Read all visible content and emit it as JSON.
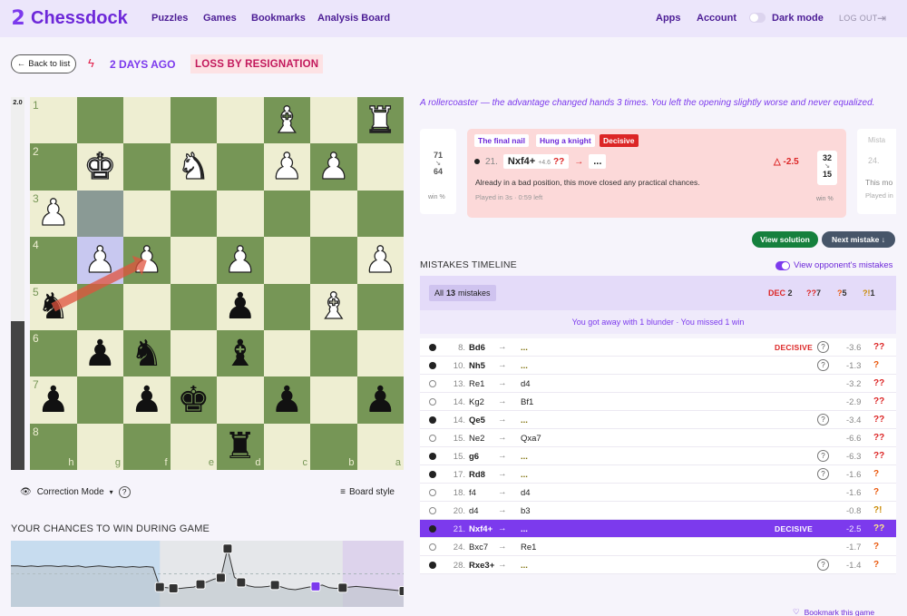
{
  "nav": {
    "logo_text": "Chessdock",
    "links": [
      "Puzzles",
      "Games",
      "Bookmarks",
      "Analysis Board"
    ],
    "apps": "Apps",
    "account": "Account",
    "dark_mode": "Dark mode",
    "logout": "LOG OUT"
  },
  "header": {
    "back": "Back to list",
    "ago": "2 DAYS AGO",
    "result": "LOSS BY RESIGNATION"
  },
  "evalbar": {
    "label": "2.0",
    "white_fraction": 0.59
  },
  "board": {
    "colors": {
      "light": "#eeeed2",
      "dark": "#769656"
    },
    "ranks": [
      "1",
      "2",
      "3",
      "4",
      "5",
      "6",
      "7",
      "8"
    ],
    "files": [
      "h",
      "g",
      "f",
      "e",
      "d",
      "c",
      "b",
      "a"
    ],
    "rows": [
      [
        "",
        "",
        "",
        "",
        "",
        "wB",
        "",
        "wR"
      ],
      [
        "",
        "wK",
        "",
        "wN",
        "",
        "wP",
        "wP",
        ""
      ],
      [
        "wP",
        "",
        "",
        "",
        "",
        "",
        "",
        ""
      ],
      [
        "",
        "wP",
        "wP",
        "",
        "wP",
        "",
        "",
        "wP"
      ],
      [
        "bN",
        "",
        "",
        "",
        "bP",
        "",
        "wB",
        ""
      ],
      [
        "",
        "bP",
        "bN",
        "",
        "bB",
        "",
        "",
        ""
      ],
      [
        "bP",
        "",
        "bP",
        "bK",
        "",
        "bP",
        "",
        "bP"
      ],
      [
        "",
        "",
        "",
        "",
        "bR",
        "",
        "",
        ""
      ]
    ],
    "highlight": [
      [
        2,
        1
      ],
      [
        3,
        1
      ]
    ],
    "arrow": {
      "from": [
        4,
        0
      ],
      "to": [
        3,
        2
      ]
    }
  },
  "under": {
    "correction": "Correction Mode",
    "board_style": "Board style"
  },
  "chances_title": "YOUR CHANCES TO WIN DURING GAME",
  "summary": "A rollercoaster — the advantage changed hands 3 times. You left the opening slightly worse and never equalized.",
  "card": {
    "tags": [
      "The final nail",
      "Hung a knight",
      "Decisive"
    ],
    "num": "21.",
    "move": "Nxf4+",
    "eval_small": "+4.6",
    "qq": "??",
    "best": "...",
    "delta": "-2.5",
    "win_before": "32",
    "win_after": "15",
    "win_lbl": "win %",
    "desc": "Already in a bad position, this move closed any practical chances.",
    "played": "Played in 3s · 0:59 left",
    "prev_win_before": "71",
    "prev_win_after": "64",
    "prev_win_lbl": "win %",
    "next_tag": "Mista",
    "next_num": "24.",
    "next_desc": "This mo",
    "next_played": "Played in"
  },
  "buttons": {
    "solution": "View solution",
    "next": "Next mistake ↓"
  },
  "timeline": {
    "title": "MISTAKES TIMELINE",
    "opponent": "View opponent's mistakes",
    "all": "All",
    "count": "13",
    "mistakes_word": "mistakes",
    "counts": [
      {
        "label": "DEC",
        "value": "2",
        "color": "#dc2626"
      },
      {
        "label": "??",
        "value": "7",
        "color": "#dc2626"
      },
      {
        "label": "?",
        "value": "5",
        "color": "#ea580c"
      },
      {
        "label": "?!",
        "value": "1",
        "color": "#ca8a04"
      }
    ],
    "sub": "You got away with 1 blunder · You missed 1 win",
    "rows": [
      {
        "dot": "filled",
        "num": "8.",
        "move": "Bd6",
        "bold": true,
        "best": "...",
        "decisive": "DECISIVE",
        "q": true,
        "ev": "-3.6",
        "sev": "??",
        "sevc": "red"
      },
      {
        "dot": "filled",
        "num": "10.",
        "move": "Nh5",
        "bold": true,
        "best": "...",
        "decisive": "",
        "q": true,
        "ev": "-1.3",
        "sev": "?",
        "sevc": "orange"
      },
      {
        "dot": "hollow",
        "num": "13.",
        "move": "Re1",
        "bold": false,
        "best": "d4",
        "decisive": "",
        "q": false,
        "ev": "-3.2",
        "sev": "??",
        "sevc": "red"
      },
      {
        "dot": "hollow",
        "num": "14.",
        "move": "Kg2",
        "bold": false,
        "best": "Bf1",
        "decisive": "",
        "q": false,
        "ev": "-2.9",
        "sev": "??",
        "sevc": "red"
      },
      {
        "dot": "filled",
        "num": "14.",
        "move": "Qe5",
        "bold": true,
        "best": "...",
        "decisive": "",
        "q": true,
        "ev": "-3.4",
        "sev": "??",
        "sevc": "red"
      },
      {
        "dot": "hollow",
        "num": "15.",
        "move": "Ne2",
        "bold": false,
        "best": "Qxa7",
        "decisive": "",
        "q": false,
        "ev": "-6.6",
        "sev": "??",
        "sevc": "red"
      },
      {
        "dot": "filled",
        "num": "15.",
        "move": "g6",
        "bold": true,
        "best": "...",
        "decisive": "",
        "q": true,
        "ev": "-6.3",
        "sev": "??",
        "sevc": "red"
      },
      {
        "dot": "filled",
        "num": "17.",
        "move": "Rd8",
        "bold": true,
        "best": "...",
        "decisive": "",
        "q": true,
        "ev": "-1.6",
        "sev": "?",
        "sevc": "orange"
      },
      {
        "dot": "hollow",
        "num": "18.",
        "move": "f4",
        "bold": false,
        "best": "d4",
        "decisive": "",
        "q": false,
        "ev": "-1.6",
        "sev": "?",
        "sevc": "orange"
      },
      {
        "dot": "hollow",
        "num": "20.",
        "move": "d4",
        "bold": false,
        "best": "b3",
        "decisive": "",
        "q": false,
        "ev": "-0.8",
        "sev": "?!",
        "sevc": "yellow"
      },
      {
        "dot": "filled",
        "num": "21.",
        "move": "Nxf4+",
        "bold": true,
        "best": "...",
        "decisive": "DECISIVE",
        "q": false,
        "ev": "-2.5",
        "sev": "??",
        "sevc": "red",
        "selected": true
      },
      {
        "dot": "hollow",
        "num": "24.",
        "move": "Bxc7",
        "bold": false,
        "best": "Re1",
        "decisive": "",
        "q": false,
        "ev": "-1.7",
        "sev": "?",
        "sevc": "orange"
      },
      {
        "dot": "filled",
        "num": "28.",
        "move": "Rxe3+",
        "bold": true,
        "best": "...",
        "decisive": "",
        "q": true,
        "ev": "-1.4",
        "sev": "?",
        "sevc": "orange"
      }
    ]
  },
  "bookmark": "Bookmark this game",
  "chances": {
    "values": [
      0.62,
      0.62,
      0.61,
      0.62,
      0.61,
      0.62,
      0.62,
      0.61,
      0.62,
      0.61,
      0.62,
      0.6,
      0.61,
      0.62,
      0.61,
      0.6,
      0.61,
      0.6,
      0.61,
      0.6,
      0.61,
      0.6,
      0.3,
      0.29,
      0.28,
      0.28,
      0.29,
      0.3,
      0.34,
      0.38,
      0.42,
      0.44,
      0.88,
      0.45,
      0.37,
      0.32,
      0.3,
      0.3,
      0.31,
      0.33,
      0.3,
      0.27,
      0.26,
      0.28,
      0.3,
      0.31,
      0.33,
      0.29,
      0.28,
      0.29,
      0.3,
      0.31,
      0.3,
      0.29,
      0.28,
      0.27,
      0.26,
      0.25,
      0.24
    ],
    "markers": [
      22,
      24,
      28,
      31,
      32,
      34,
      39,
      45,
      49,
      59
    ],
    "selected_marker": 45
  }
}
